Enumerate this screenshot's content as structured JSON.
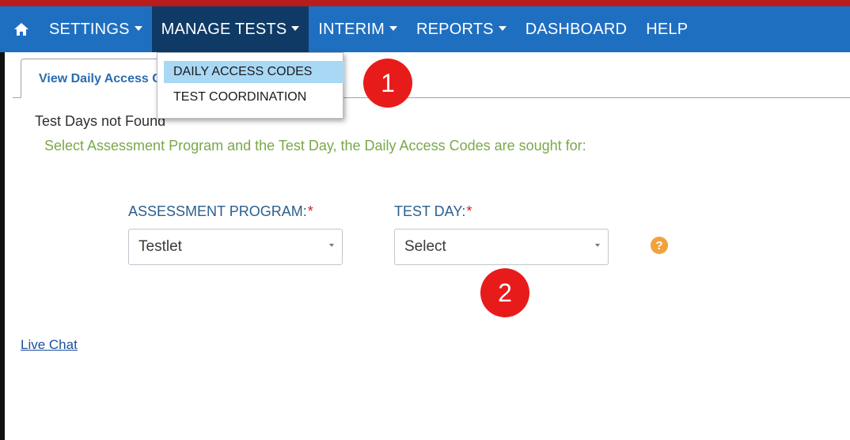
{
  "nav": {
    "home_icon": "home-icon",
    "items": [
      {
        "label": "SETTINGS",
        "has_caret": true
      },
      {
        "label": "MANAGE TESTS",
        "has_caret": true,
        "active": true
      },
      {
        "label": "INTERIM",
        "has_caret": true
      },
      {
        "label": "REPORTS",
        "has_caret": true
      },
      {
        "label": "DASHBOARD",
        "has_caret": false
      },
      {
        "label": "HELP",
        "has_caret": false
      }
    ]
  },
  "dropdown": {
    "items": [
      {
        "label": "DAILY ACCESS CODES",
        "highlighted": true
      },
      {
        "label": "TEST COORDINATION",
        "highlighted": false
      }
    ]
  },
  "tabs": [
    {
      "label": "View Daily Access Codes"
    }
  ],
  "callouts": [
    {
      "label": "1"
    },
    {
      "label": "2"
    }
  ],
  "messages": {
    "not_found": "Test Days not Found",
    "instruction": "Select Assessment Program and the Test Day, the Daily Access Codes are sought for:"
  },
  "form": {
    "assessment_program": {
      "label": "ASSESSMENT PROGRAM:",
      "required_mark": "*",
      "value": "Testlet"
    },
    "test_day": {
      "label": "TEST DAY:",
      "required_mark": "*",
      "value": "Select"
    },
    "help_icon": "?"
  },
  "footer": {
    "live_chat": "Live Chat"
  },
  "colors": {
    "navbar": "#1f6fc1",
    "nav_active": "#0f3a66",
    "top_strip": "#b81c1c",
    "dropdown_highlight": "#a9d8f5",
    "callout": "#e81b1b",
    "instruction_text": "#79a84a",
    "label_text": "#2b5f8c",
    "help_icon": "#f0a23c"
  }
}
